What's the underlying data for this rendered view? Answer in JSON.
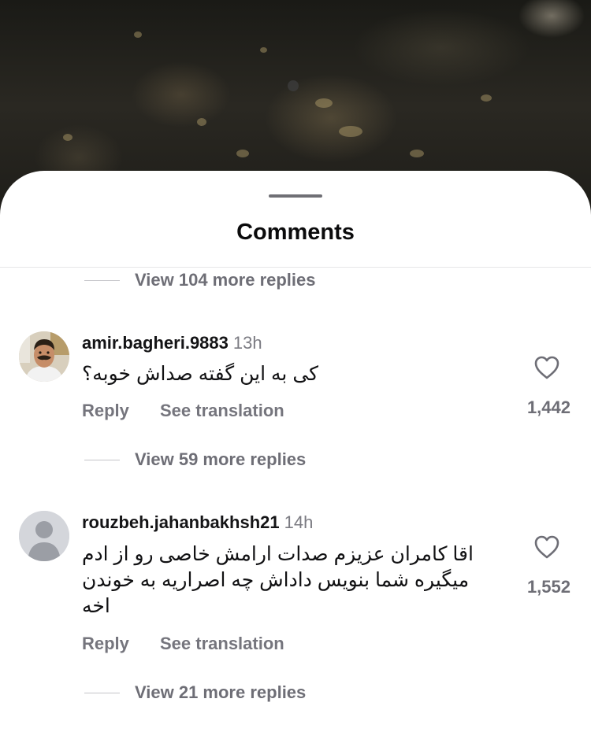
{
  "sheet": {
    "title": "Comments"
  },
  "threads": [
    {
      "view_more": "View 104 more replies"
    },
    {
      "username": "amir.bagheri.9883",
      "time": "13h",
      "text": "کی به این گفته صداش خوبه؟",
      "reply_label": "Reply",
      "translate_label": "See translation",
      "likes": "1,442",
      "view_more": "View 59 more replies"
    },
    {
      "username": "rouzbeh.jahanbakhsh21",
      "time": "14h",
      "text": "اقا کامران عزیزم صدات ارامش خاصی رو از ادم میگیره شما بنویس داداش چه اصراریه به خوندن اخه",
      "reply_label": "Reply",
      "translate_label": "See translation",
      "likes": "1,552",
      "view_more": "View 21 more replies"
    }
  ],
  "icons": {
    "like": "heart-outline-icon",
    "default_avatar": "person-silhouette-icon"
  },
  "colors": {
    "text_primary": "#141416",
    "text_secondary": "#6e6e76",
    "sheet_bg": "#ffffff"
  }
}
